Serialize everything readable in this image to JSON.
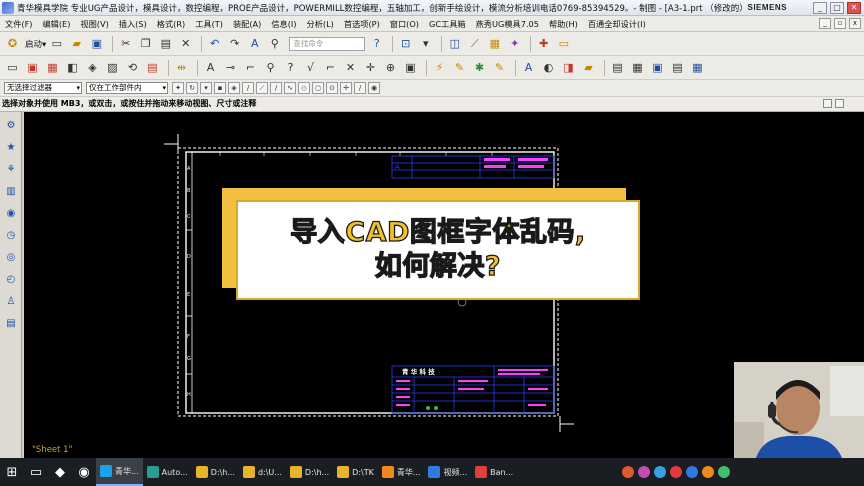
{
  "titlebar": {
    "title": "青华模具学院 专业UG产品设计，模具设计，数控编程，PROE产品设计，POWERMILL数控编程，五轴加工，创新手绘设计，模流分析培训电话0769-85394529。- 制图 - [A3-1.prt （修改的） ]",
    "brand": "SIEMENS",
    "buttons": [
      "_",
      "□",
      "✕"
    ]
  },
  "menu": {
    "items": [
      "文件(F)",
      "编辑(E)",
      "视图(V)",
      "插入(S)",
      "格式(R)",
      "工具(T)",
      "装配(A)",
      "信息(I)",
      "分析(L)",
      "首选项(P)",
      "窗口(O)",
      "GC工具箱",
      "燕秀UG模具7.05",
      "帮助(H)",
      "百通全却设计(I)"
    ]
  },
  "toolbar": {
    "start_label": "启动▾",
    "search_placeholder": "查找命令"
  },
  "selection": {
    "filter": "无选择过滤器",
    "scope": "仅在工作部件内"
  },
  "status": {
    "prompt": "选择对象并使用 MB3，或双击，或按住并拖动来移动视图、尺寸或注释"
  },
  "graphics": {
    "sheet_label": "\"Sheet 1\"",
    "titleblock_text": "青  华  科  技"
  },
  "overlay": {
    "line1": "导入CAD图框字体乱码,",
    "line2": "如何解决?"
  },
  "taskbar": {
    "items": [
      {
        "label": "青华...",
        "color": "#1aa3e8"
      },
      {
        "label": "Auto...",
        "color": "#2a9d8f"
      },
      {
        "label": "D:\\h...",
        "color": "#e8b22a"
      },
      {
        "label": "d:\\U...",
        "color": "#e8b22a"
      },
      {
        "label": "D:\\h...",
        "color": "#e8b22a"
      },
      {
        "label": "D:\\TK",
        "color": "#e8b22a"
      },
      {
        "label": "青华...",
        "color": "#f0891c"
      },
      {
        "label": "视频...",
        "color": "#2f7be0"
      },
      {
        "label": "Ban...",
        "color": "#e0403a"
      }
    ]
  },
  "colors": {
    "cad_frame": "#ffffff",
    "cad_blue": "#2a3dff",
    "cad_magenta": "#ff3cff",
    "overlay_yellow": "#f2c028"
  }
}
